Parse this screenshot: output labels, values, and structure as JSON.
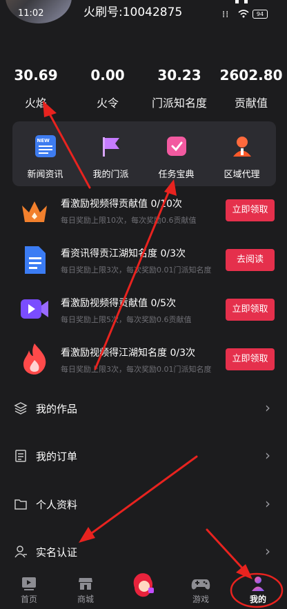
{
  "status": {
    "time": "11:02",
    "battery": "94"
  },
  "user": {
    "uid_label": "火刷号:10042875"
  },
  "stats": [
    {
      "value": "30.69",
      "label": "火焰"
    },
    {
      "value": "0.00",
      "label": "火令"
    },
    {
      "value": "30.23",
      "label": "门派知名度"
    },
    {
      "value": "2602.80",
      "label": "贡献值"
    }
  ],
  "quick": [
    {
      "label": "新闻资讯",
      "icon": "news-icon",
      "badge": "NEW"
    },
    {
      "label": "我的门派",
      "icon": "flag-icon"
    },
    {
      "label": "任务宝典",
      "icon": "task-check-icon"
    },
    {
      "label": "区域代理",
      "icon": "agent-icon"
    }
  ],
  "tasks": [
    {
      "title": "看激励视频得贡献值  0/10次",
      "sub": "每日奖励上限10次，每次奖励0.6贡献值",
      "button": "立即领取",
      "icon": "crown-icon"
    },
    {
      "title": "看资讯得贡江湖知名度  0/3次",
      "sub": "每日奖励上限3次，每次奖励0.01门派知名度",
      "button": "去阅读",
      "icon": "document-icon"
    },
    {
      "title": "看激励视频得贡献值  0/5次",
      "sub": "每日奖励上限5次，每次奖励0.6贡献值",
      "button": "立即领取",
      "icon": "video-icon"
    },
    {
      "title": "看激励视频得江湖知名度  0/3次",
      "sub": "每日奖励上限3次，每次奖励0.01门派知名度",
      "button": "立即领取",
      "icon": "flame-icon"
    }
  ],
  "menu": [
    {
      "label": "我的作品",
      "icon": "layers-icon"
    },
    {
      "label": "我的订单",
      "icon": "order-icon"
    },
    {
      "label": "个人资料",
      "icon": "folder-icon"
    },
    {
      "label": "实名认证",
      "icon": "user-verify-icon"
    }
  ],
  "nav": [
    {
      "label": "首页",
      "icon": "home-tv-icon"
    },
    {
      "label": "商城",
      "icon": "shop-icon"
    },
    {
      "label": "",
      "icon": "center-mascot-icon"
    },
    {
      "label": "游戏",
      "icon": "gamepad-icon"
    },
    {
      "label": "我的",
      "icon": "profile-icon",
      "active": true
    }
  ],
  "colors": {
    "accent": "#e5304c",
    "background": "#1c1c1e",
    "panel": "#2c2c31",
    "annotation": "#e8231f"
  }
}
